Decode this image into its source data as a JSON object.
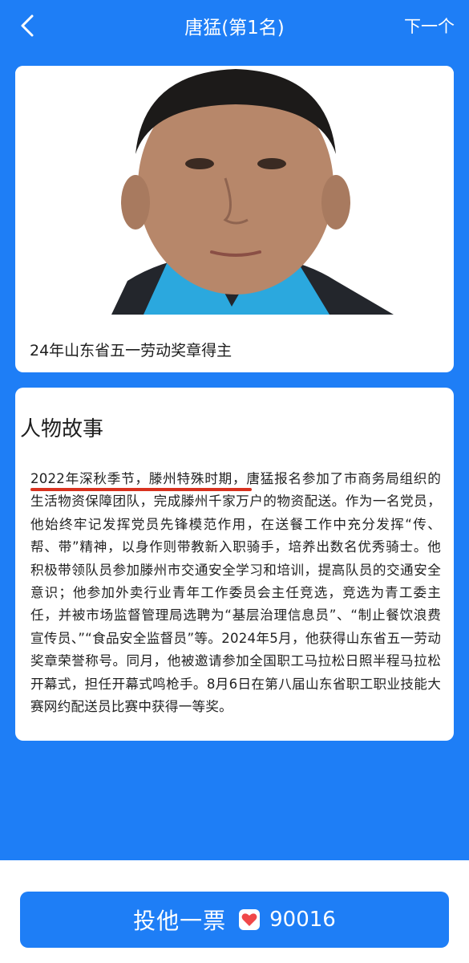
{
  "header": {
    "title": "唐猛(第1名)",
    "next_label": "下一个"
  },
  "profile": {
    "caption": "24年山东省五一劳动奖章得主"
  },
  "story": {
    "title": "人物故事",
    "highlight": "2022年深秋季节，滕州特殊时期，",
    "body": "唐猛报名参加了市商务局组织的生活物资保障团队，完成滕州千家万户的物资配送。作为一名党员，他始终牢记发挥党员先锋模范作用，在送餐工作中充分发挥“传、帮、带”精神，以身作则带教新入职骑手，培养出数名优秀骑士。他积极带领队员参加滕州市交通安全学习和培训，提高队员的交通安全意识；他参加外卖行业青年工作委员会主任竞选，竞选为青工委主任，并被市场监督管理局选聘为“基层治理信息员”、“制止餐饮浪费宣传员、”“食品安全监督员”等。2024年5月，他获得山东省五一劳动奖章荣誉称号。同月，他被邀请参加全国职工马拉松日照半程马拉松开幕式，担任开幕式鸣枪手。8月6日在第八届山东省职工职业技能大赛网约配送员比赛中获得一等奖。"
  },
  "vote": {
    "label": "投他一票",
    "count": "90016"
  },
  "colors": {
    "primary": "#1e7ef6",
    "heart": "#f0484a",
    "underline": "#d8321f"
  }
}
